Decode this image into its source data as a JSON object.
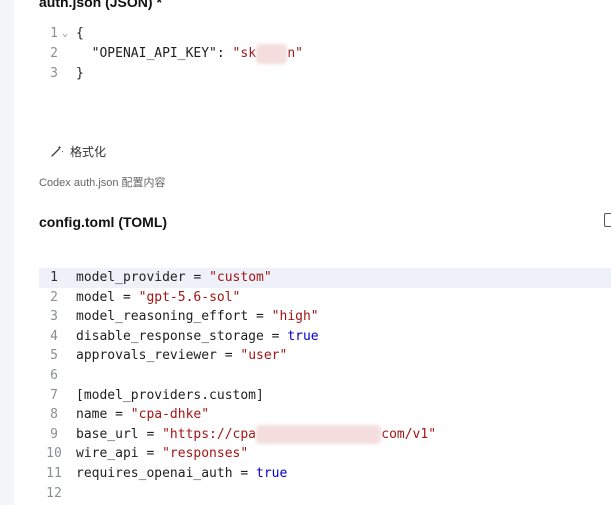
{
  "auth": {
    "title": "auth.json (JSON) *",
    "lines": [
      {
        "num": "1",
        "fold": true,
        "tokens": [
          {
            "t": "{",
            "c": "key"
          }
        ]
      },
      {
        "num": "2",
        "tokens": [
          {
            "t": "  \"OPENAI_API_KEY\": ",
            "c": "key"
          },
          {
            "t": "\"sk",
            "c": "str"
          },
          {
            "t": "xxxx",
            "c": "redact"
          },
          {
            "t": "n\"",
            "c": "str"
          }
        ]
      },
      {
        "num": "3",
        "tokens": [
          {
            "t": "}",
            "c": "key"
          }
        ]
      }
    ],
    "format_label": "格式化",
    "helper": "Codex auth.json 配置内容"
  },
  "config": {
    "title": "config.toml (TOML)",
    "lines": [
      {
        "num": "1",
        "active": true,
        "tokens": [
          {
            "t": "model_provider = ",
            "c": "key"
          },
          {
            "t": "\"custom\"",
            "c": "str"
          }
        ]
      },
      {
        "num": "2",
        "tokens": [
          {
            "t": "model = ",
            "c": "key"
          },
          {
            "t": "\"gpt-5.6-sol\"",
            "c": "str"
          }
        ]
      },
      {
        "num": "3",
        "tokens": [
          {
            "t": "model_reasoning_effort = ",
            "c": "key"
          },
          {
            "t": "\"high\"",
            "c": "str"
          }
        ]
      },
      {
        "num": "4",
        "tokens": [
          {
            "t": "disable_response_storage = ",
            "c": "key"
          },
          {
            "t": "true",
            "c": "bool"
          }
        ]
      },
      {
        "num": "5",
        "tokens": [
          {
            "t": "approvals_reviewer = ",
            "c": "key"
          },
          {
            "t": "\"user\"",
            "c": "str"
          }
        ]
      },
      {
        "num": "6",
        "tokens": []
      },
      {
        "num": "7",
        "tokens": [
          {
            "t": "[model_providers.custom]",
            "c": "key"
          }
        ]
      },
      {
        "num": "8",
        "tokens": [
          {
            "t": "name = ",
            "c": "key"
          },
          {
            "t": "\"cpa-dhke\"",
            "c": "str"
          }
        ]
      },
      {
        "num": "9",
        "tokens": [
          {
            "t": "base_url = ",
            "c": "key"
          },
          {
            "t": "\"https://cpa",
            "c": "str"
          },
          {
            "t": "xxxxxxxxxxxxxxxx",
            "c": "redact"
          },
          {
            "t": "com/v1\"",
            "c": "str"
          }
        ]
      },
      {
        "num": "10",
        "tokens": [
          {
            "t": "wire_api = ",
            "c": "key"
          },
          {
            "t": "\"responses\"",
            "c": "str"
          }
        ]
      },
      {
        "num": "11",
        "tokens": [
          {
            "t": "requires_openai_auth = ",
            "c": "key"
          },
          {
            "t": "true",
            "c": "bool"
          }
        ]
      },
      {
        "num": "12",
        "tokens": []
      }
    ]
  },
  "icons": {
    "format": "magic-wand-icon",
    "fold": "chevron-down-icon",
    "toolbar": "fullscreen-icon"
  }
}
